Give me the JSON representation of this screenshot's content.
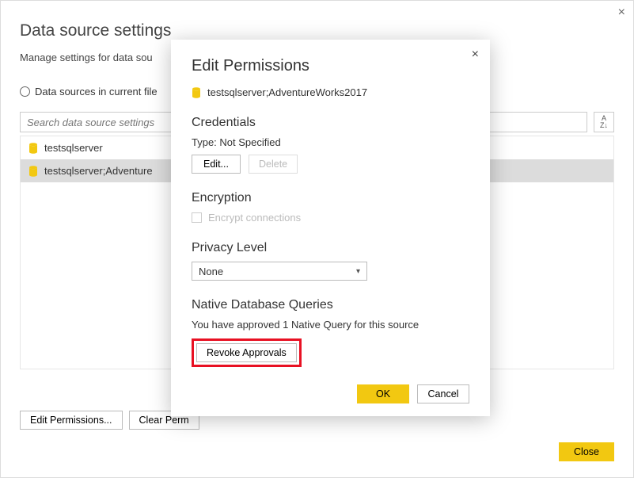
{
  "main": {
    "title": "Data source settings",
    "subtitle": "Manage settings for data sou",
    "scopeLabel": "Data sources in current file",
    "searchPlaceholder": "Search data source settings",
    "sortGlyph": "A↓",
    "items": [
      {
        "label": "testsqlserver",
        "selected": false
      },
      {
        "label": "testsqlserver;Adventure",
        "selected": true
      }
    ],
    "editPermsBtn": "Edit Permissions...",
    "clearPermsBtn": "Clear Perm",
    "closeBtn": "Close"
  },
  "modal": {
    "title": "Edit Permissions",
    "sourceName": "testsqlserver;AdventureWorks2017",
    "credentialsHead": "Credentials",
    "credType": "Type: Not Specified",
    "editBtn": "Edit...",
    "deleteBtn": "Delete",
    "encryptionHead": "Encryption",
    "encryptLabel": "Encrypt connections",
    "privacyHead": "Privacy Level",
    "privacyValue": "None",
    "nativeHead": "Native Database Queries",
    "nativeText": "You have approved 1 Native Query for this source",
    "revokeBtn": "Revoke Approvals",
    "okBtn": "OK",
    "cancelBtn": "Cancel"
  }
}
